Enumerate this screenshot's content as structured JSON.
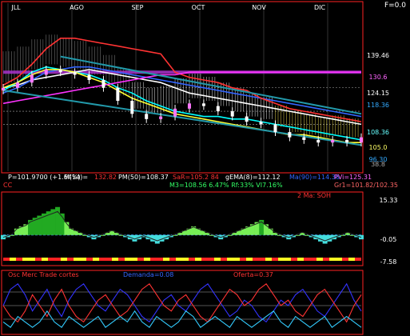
{
  "chart_data": [
    {
      "type": "line",
      "panel": "price",
      "months": [
        "JLL",
        "AGO",
        "SEP",
        "OCT",
        "NOV",
        "DIC"
      ],
      "corner_label": "F=0.0",
      "price_axis": {
        "labels": [
          "139.46",
          "130.6",
          "124.15",
          "118.36",
          "108.36",
          "105.0",
          "96.30",
          "38.8"
        ],
        "colors": [
          "#ffffff",
          "#ff66ff",
          "#ffffff",
          "#33aaff",
          "#66ffff",
          "#ffff66",
          "#33aaff",
          "#aaaaaa"
        ]
      },
      "ylim": [
        86,
        148
      ],
      "series": [
        {
          "color": "#ffffff",
          "values": [
            118,
            119,
            121,
            122,
            123,
            124,
            125,
            124,
            123,
            122,
            121,
            120,
            118,
            116,
            115,
            114,
            113,
            112,
            111,
            110,
            109,
            108,
            107,
            106,
            105,
            104
          ]
        },
        {
          "color": "#00ffff",
          "values": [
            117,
            120,
            124,
            126,
            125,
            124,
            123,
            121,
            118,
            116,
            113,
            111,
            109,
            108,
            107,
            107,
            106,
            106,
            105,
            104,
            103,
            102,
            101,
            100,
            99,
            98
          ]
        },
        {
          "color": "#3366ff",
          "values": [
            116,
            118,
            121,
            124,
            125,
            126,
            126,
            125,
            124,
            123,
            122,
            121,
            120,
            119,
            118,
            117,
            116,
            115,
            114,
            113,
            112,
            111,
            110,
            109,
            108,
            107
          ]
        },
        {
          "color": "#ff3333",
          "values": [
            119,
            122,
            127,
            133,
            137,
            137,
            136,
            135,
            134,
            133,
            132,
            131,
            124,
            122,
            121,
            120,
            118,
            117,
            114,
            112,
            110,
            109,
            108,
            107,
            106,
            105
          ]
        },
        {
          "color": "#ffff33",
          "values": [
            118,
            120,
            123,
            125,
            125,
            124,
            122,
            120,
            117,
            114,
            112,
            110,
            108,
            107,
            106,
            105,
            104,
            103,
            102,
            101,
            100,
            100,
            99,
            98,
            97,
            97
          ]
        },
        {
          "color": "#ff33ff",
          "values": [
            112,
            113,
            114,
            115,
            116,
            117,
            118,
            119,
            120,
            121,
            122,
            123,
            123,
            124,
            124,
            124,
            124,
            124,
            124,
            124,
            124,
            124,
            124,
            124,
            124,
            124
          ]
        }
      ],
      "candles_close": [
        118,
        120,
        123,
        125,
        124,
        123,
        121,
        118,
        113,
        108,
        106,
        107,
        110,
        112,
        111,
        109,
        107,
        105,
        104,
        101,
        99,
        98,
        97,
        98,
        97,
        99
      ],
      "info_lines": [
        {
          "text": "P=101.9700 (+1.64%)",
          "color": "#ffffff"
        },
        {
          "text": "M(14)=",
          "color": "#ffffff"
        },
        {
          "text": "132.82",
          "color": "#ff3333"
        },
        {
          "text": "PM(50)=108.37",
          "color": "#ffffff"
        },
        {
          "text": "SaR=105.2 84",
          "color": "#ff3333"
        },
        {
          "text": "gEMA(8)=112.12",
          "color": "#ffffff"
        },
        {
          "text": "Ma(90)=114.38",
          "color": "#3366ff"
        },
        {
          "text": "PVi=125.31",
          "color": "#ff66ff"
        },
        {
          "text": "M3=108.56 6.47% Rf:33% VI7.16%",
          "color": "#33ff66"
        },
        {
          "text": "Gr1=101.82/102.35",
          "color": "#ff6666"
        },
        {
          "text": "CC",
          "color": "#ff3333"
        }
      ]
    },
    {
      "type": "area",
      "panel": "oscillator",
      "title": "2 Ma: SOH",
      "ticks": [
        "15.33",
        "-0.05",
        "-7.58"
      ],
      "ylim": [
        -9,
        17
      ],
      "values": [
        -2,
        -1,
        0,
        3,
        4,
        5,
        7,
        8,
        9,
        10,
        11,
        12,
        13,
        10,
        6,
        3,
        2,
        1,
        0,
        -1,
        -2,
        -1,
        0,
        1,
        2,
        1,
        0,
        -1,
        -2,
        -3,
        -2,
        -1,
        -2,
        -3,
        -4,
        -3,
        -2,
        -1,
        0,
        1,
        2,
        3,
        4,
        3,
        2,
        1,
        0,
        -1,
        -2,
        -1,
        0,
        1,
        2,
        3,
        4,
        5,
        6,
        7,
        5,
        3,
        1,
        0,
        -1,
        -2,
        -1,
        0,
        1,
        0,
        -1,
        -2,
        -3,
        -4,
        -3,
        -2,
        -1,
        0,
        1,
        0,
        -1,
        -2
      ]
    },
    {
      "type": "line",
      "panel": "bottom",
      "labels": [
        {
          "text": "Osc Merc Trade cortes",
          "color": "#ff3333"
        },
        {
          "text": "Demanda=0.08",
          "color": "#3366ff"
        },
        {
          "text": "Oferta=0.37",
          "color": "#ff3333"
        }
      ],
      "ylim": [
        0,
        10
      ],
      "series": [
        {
          "color": "#3333ff",
          "values": [
            5,
            8,
            9,
            7,
            4,
            6,
            8,
            5,
            3,
            6,
            8,
            9,
            7,
            5,
            4,
            6,
            8,
            7,
            5,
            3,
            2,
            4,
            6,
            7,
            5,
            4,
            6,
            8,
            9,
            7,
            5,
            3,
            4,
            6,
            5,
            3,
            2,
            4,
            6,
            5,
            7,
            8,
            6,
            4,
            3,
            5,
            7,
            9,
            6,
            4
          ]
        },
        {
          "color": "#ff3333",
          "values": [
            5,
            3,
            2,
            4,
            7,
            5,
            3,
            6,
            8,
            5,
            3,
            2,
            4,
            6,
            7,
            5,
            3,
            4,
            6,
            8,
            9,
            7,
            5,
            4,
            6,
            7,
            5,
            3,
            2,
            4,
            6,
            8,
            7,
            5,
            6,
            8,
            9,
            7,
            5,
            6,
            4,
            3,
            5,
            7,
            8,
            6,
            4,
            2,
            5,
            7
          ]
        },
        {
          "color": "#33ccff",
          "values": [
            2,
            1,
            3,
            2,
            1,
            2,
            4,
            2,
            1,
            3,
            2,
            1,
            2,
            3,
            1,
            2,
            3,
            2,
            4,
            2,
            1,
            3,
            2,
            1,
            2,
            4,
            3,
            1,
            2,
            3,
            2,
            1,
            3,
            2,
            1,
            2,
            3,
            4,
            2,
            1,
            3,
            2,
            1,
            2,
            3,
            1,
            2,
            3,
            2,
            1
          ]
        }
      ]
    }
  ]
}
